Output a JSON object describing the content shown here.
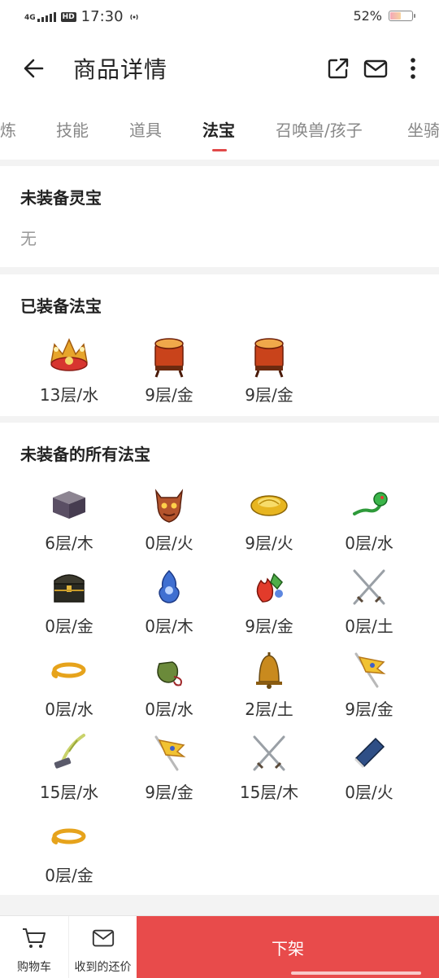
{
  "status_bar": {
    "network": "4G",
    "hd": "HD",
    "time": "17:30",
    "battery": "52%"
  },
  "header": {
    "title": "商品详情"
  },
  "tabs": [
    {
      "label": "炼"
    },
    {
      "label": "技能"
    },
    {
      "label": "道具"
    },
    {
      "label": "法宝",
      "active": true
    },
    {
      "label": "召唤兽/孩子"
    },
    {
      "label": "坐骑"
    }
  ],
  "sections": {
    "unequipped_lingbao": {
      "title": "未装备灵宝",
      "empty_text": "无"
    },
    "equipped_fabao": {
      "title": "已装备法宝",
      "items": [
        {
          "icon": "crown-icon",
          "label": "13层/水"
        },
        {
          "icon": "drum-icon",
          "label": "9层/金"
        },
        {
          "icon": "drum-icon",
          "label": "9层/金"
        }
      ]
    },
    "all_unequipped_fabao": {
      "title": "未装备的所有法宝",
      "items": [
        {
          "icon": "box-icon",
          "label": "6层/木"
        },
        {
          "icon": "demon-mask-icon",
          "label": "0层/火"
        },
        {
          "icon": "gold-ingot-icon",
          "label": "9层/火"
        },
        {
          "icon": "jade-dragon-icon",
          "label": "0层/水"
        },
        {
          "icon": "chest-icon",
          "label": "0层/金"
        },
        {
          "icon": "blue-spirit-icon",
          "label": "0层/木"
        },
        {
          "icon": "flame-jewel-icon",
          "label": "9层/金"
        },
        {
          "icon": "crossed-swords-icon",
          "label": "0层/土"
        },
        {
          "icon": "gold-rope-icon",
          "label": "0层/水"
        },
        {
          "icon": "pouch-icon",
          "label": "0层/水"
        },
        {
          "icon": "bell-icon",
          "label": "2层/土"
        },
        {
          "icon": "banner-icon",
          "label": "9层/金"
        },
        {
          "icon": "feather-brush-icon",
          "label": "15层/水"
        },
        {
          "icon": "banner-icon",
          "label": "9层/金"
        },
        {
          "icon": "crossed-swords-icon",
          "label": "15层/木"
        },
        {
          "icon": "blue-book-icon",
          "label": "0层/火"
        },
        {
          "icon": "gold-rope-icon",
          "label": "0层/金"
        }
      ]
    }
  },
  "bottom_bar": {
    "cart_label": "购物车",
    "offers_label": "收到的还价",
    "delist_label": "下架"
  },
  "colors": {
    "accent": "#e84b4b",
    "tab_indicator": "#e14a4a"
  }
}
